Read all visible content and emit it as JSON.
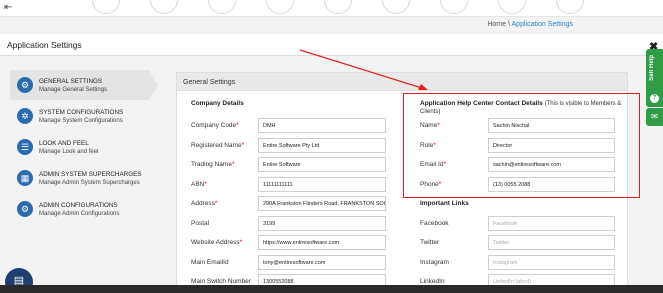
{
  "nav": {
    "back_icon": "back-arrow-icon"
  },
  "breadcrumb": {
    "home": "Home",
    "separator": "\\",
    "current": "Application Settings"
  },
  "page_title": "Application Settings",
  "sidebar": {
    "items": [
      {
        "title": "GENERAL SETTINGS",
        "subtitle": "Manage General Settings",
        "icon": "gear-icon",
        "active": true
      },
      {
        "title": "SYSTEM CONFIGURATIONS",
        "subtitle": "Manage System Configurations",
        "icon": "cogs-icon",
        "active": false
      },
      {
        "title": "LOOK AND FEEL",
        "subtitle": "Manage Look and feel",
        "icon": "list-icon",
        "active": false
      },
      {
        "title": "ADMIN SYSTEM SUPERCHARGES",
        "subtitle": "Manage Admin System Supercharges",
        "icon": "supercharge-icon",
        "active": false
      },
      {
        "title": "ADMIN CONFIGURATIONS",
        "subtitle": "Manage Admin Configurations",
        "icon": "admin-gear-icon",
        "active": false
      }
    ]
  },
  "general": {
    "header": "General Settings",
    "company_details": {
      "heading": "Company Details",
      "fields": [
        {
          "label": "Company Code",
          "required": "*",
          "value": "DMH"
        },
        {
          "label": "Registered Name",
          "required": "*",
          "value": "Entire Software Pty Ltd"
        },
        {
          "label": "Trading Name",
          "required": "*",
          "value": "Entire Software"
        },
        {
          "label": "ABN",
          "required": "*",
          "value": "11111111111"
        },
        {
          "label": "Address",
          "required": "*",
          "value": "290A Frankston Flinders Road, FRANKSTON SOU"
        },
        {
          "label": "Postal",
          "required": "",
          "value": "3199"
        },
        {
          "label": "Website Address",
          "required": "*",
          "value": "https://www.entiresoftware.com"
        },
        {
          "label": "Main EmailId",
          "required": "",
          "value": "tony@entiresoftware.com"
        },
        {
          "label": "Main Switch Number",
          "required": "",
          "value": "1300552088"
        }
      ]
    },
    "help_center": {
      "heading": "Application Help Center Contact Details",
      "note": "(This is visible to Members & Clients)",
      "fields": [
        {
          "label": "Name",
          "required": "*",
          "value": "Sachin Nischal"
        },
        {
          "label": "Role",
          "required": "*",
          "value": "Director"
        },
        {
          "label": "Email Id",
          "required": "*",
          "value": "sachin@entiresoftware.com"
        },
        {
          "label": "Phone",
          "required": "*",
          "value": "(13) 0055 2088"
        }
      ]
    },
    "important_links": {
      "heading": "Important Links",
      "fields": [
        {
          "label": "Facebook",
          "placeholder": "Facebook"
        },
        {
          "label": "Twitter",
          "placeholder": "Twitter"
        },
        {
          "label": "Instagram",
          "placeholder": "Instagram"
        },
        {
          "label": "LinkedIn",
          "placeholder": "LinkedIn (abcd)"
        }
      ]
    }
  },
  "widgets": {
    "close": "✖",
    "self_help": "Self Help",
    "self_help_icon": "question-icon",
    "chat_icon": "chat-icon",
    "float_icon": "clipboard-icon"
  },
  "colors": {
    "accent": "#2a7fd4",
    "icon_blue": "#2b6cb0",
    "highlight": "#e02020",
    "help_green": "#2e9d46"
  }
}
